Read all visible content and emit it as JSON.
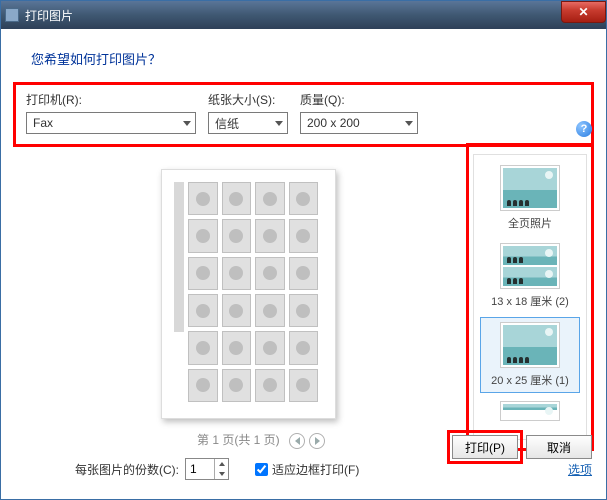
{
  "window": {
    "title": "打印图片"
  },
  "header": {
    "question": "您希望如何打印图片？"
  },
  "fields": {
    "printer": {
      "label": "打印机(R):",
      "value": "Fax"
    },
    "paper": {
      "label": "纸张大小(S):",
      "value": "信纸"
    },
    "quality": {
      "label": "质量(Q):",
      "value": "200 x 200"
    }
  },
  "help_icon_text": "?",
  "pager": {
    "text": "第 1 页(共 1 页)"
  },
  "layouts": {
    "items": [
      {
        "label": "全页照片"
      },
      {
        "label": "13 x 18 厘米 (2)"
      },
      {
        "label": "20 x 25 厘米 (1)"
      },
      {
        "label": ""
      }
    ]
  },
  "footer": {
    "copies_label": "每张图片的份数(C):",
    "copies_value": "1",
    "fit_label": "适应边框打印(F)",
    "fit_checked": true,
    "options_link": "选项"
  },
  "buttons": {
    "print": "打印(P)",
    "cancel": "取消"
  }
}
